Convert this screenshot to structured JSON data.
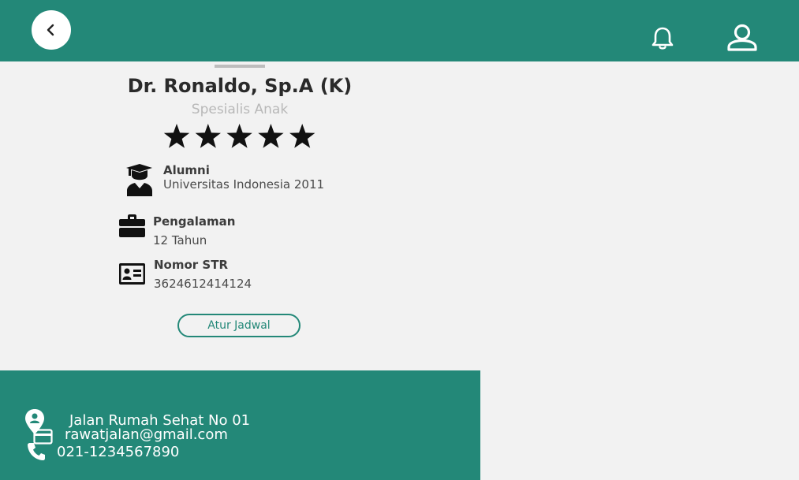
{
  "header": {
    "back_icon": "chevron-left-icon",
    "notification_icon": "bell-icon",
    "profile_icon": "user-icon"
  },
  "doctor": {
    "name": "Dr. Ronaldo, Sp.A (K)",
    "specialty": "Spesialis Anak",
    "rating": 5,
    "rating_max": 5
  },
  "info": [
    {
      "icon": "graduate-icon",
      "title": "Alumni",
      "value": "Universitas Indonesia 2011"
    },
    {
      "icon": "briefcase-icon",
      "title": "Pengalaman",
      "value": "12 Tahun"
    },
    {
      "icon": "id-card-icon",
      "title": "Nomor STR",
      "value": "3624612414124"
    }
  ],
  "actions": {
    "schedule_label": "Atur Jadwal"
  },
  "footer": {
    "address": "Jalan Rumah Sehat No 01",
    "email": "rawatjalan@gmail.com",
    "phone": "021-1234567890"
  },
  "colors": {
    "primary": "#238878",
    "background": "#f2f2f2",
    "text_dark": "#2a2a2a",
    "text_muted": "#b8b8b8"
  }
}
